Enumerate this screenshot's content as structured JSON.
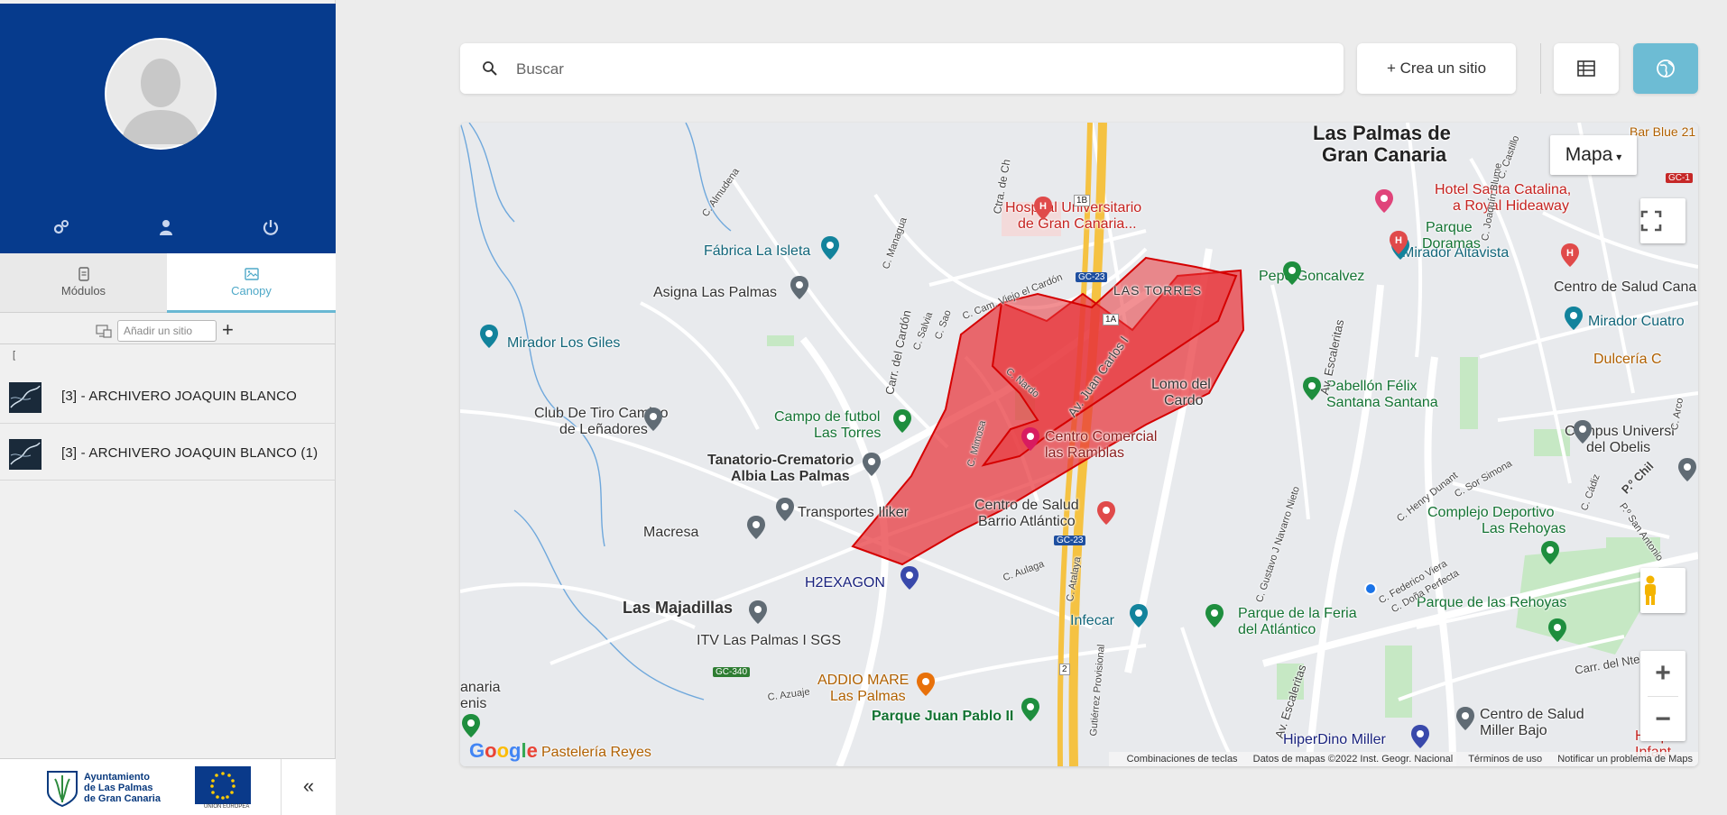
{
  "sidebar": {
    "tabs": [
      {
        "label": "Módulos"
      },
      {
        "label": "Canopy"
      }
    ],
    "add_site_placeholder": "Añadir un sitio",
    "bracket": "[",
    "sites": [
      {
        "label": "[3] - ARCHIVERO JOAQUIN BLANCO"
      },
      {
        "label": "[3] - ARCHIVERO JOAQUIN BLANCO (1)"
      }
    ],
    "footer": {
      "logo_line1": "Ayuntamiento",
      "logo_line2": "de Las Palmas",
      "logo_line3": "de Gran Canaria",
      "eu_text": "UNIÓN EUROPEA",
      "collapse_symbol": "«"
    }
  },
  "toolbar": {
    "search_placeholder": "Buscar",
    "create_label": "+ Crea un sitio"
  },
  "map": {
    "map_type_label": "Mapa",
    "labels": {
      "city": "Las Palmas de",
      "city2": "Gran Canaria",
      "hospital": "Hospital Universitario",
      "hospital2": "de Gran Canaria...",
      "fabrica": "Fábrica La Isleta",
      "asigna": "Asigna Las Palmas",
      "mirador_giles": "Mirador Los Giles",
      "las_torres": "LAS TORRES",
      "pepe": "Pepe Goncalvez",
      "mirador_altavista": "Mirador Altavista",
      "parque_doramas": "Parque",
      "parque_doramas2": "Doramas",
      "hotel": "Hotel Santa Catalina,",
      "hotel2": "a Royal Hideaway",
      "centro_canarias": "Centro de Salud Cana",
      "mirador_cuatro": "Mirador Cuatro",
      "dulceria": "Dulcería C",
      "club": "Club De Tiro Camino",
      "club2": "de Leñadores",
      "campo": "Campo de futbol",
      "campo2": "Las Torres",
      "centro_comercial": "Centro Comercial",
      "centro_comercial2": "las Ramblas",
      "lomo": "Lomo del",
      "lomo2": "Cardo",
      "pabellon": "Pabellón Félix",
      "pabellon2": "Santana Santana",
      "campus": "Campus Universi",
      "campus2": "del Obelis",
      "tanatorio": "Tanatorio-Crematorio",
      "tanatorio2": "Albia Las Palmas",
      "transportes": "Transportes Iliker",
      "macresa": "Macresa",
      "centro_atlantico": "Centro de Salud",
      "centro_atlantico2": "Barrio Atlántico",
      "complejo": "Complejo Deportivo",
      "complejo2": "Las Rehoyas",
      "h2exagon": "H2EXAGON",
      "majadillas": "Las Majadillas",
      "parque_feria": "Parque de la Feria",
      "parque_feria2": "del Atlántico",
      "parque_rehoyas": "Parque de las Rehoyas",
      "itv": "ITV Las Palmas I SGS",
      "infecar": "Infecar",
      "addio": "ADDIO MARE",
      "addio2": "Las Palmas",
      "parque_juan": "Parque Juan Pablo II",
      "centro_miller": "Centro de Salud",
      "centro_miller2": "Miller Bajo",
      "hiperdino": "HiperDino Miller",
      "hospital_right": "Hospita",
      "hospital_right2": "Infant",
      "pasteleria": "Pastelería Reyes",
      "canaria": "anaria",
      "tenis": "enis",
      "av_escaleritas": "Av. Escaleritas",
      "av_escaleritas2": "Av. Escaleritas",
      "carr_cardon": "Carr. del Cardón",
      "av_juan_carlos": "Av. Juan Carlos I",
      "c_mimosa": "C. Mimosa",
      "c_nardo": "C. Nardo",
      "c_azuaje": "C. Azuaje",
      "c_almudena": "C. Almudena",
      "c_sor_simona": "C. Sor Simona",
      "carr_nte": "Carr. del Nte.",
      "c_henry": "C. Henry Dunant",
      "c_gustavo": "C. Gustavo J Navarro Nieto",
      "c_viejo": "C. Cam. Viejo el Cardón",
      "ctra": "Ctra. de Ch",
      "c_manzuga": "C. Managua",
      "c_salvia": "C. Salvia",
      "c_sao": "C. Sao",
      "c_federico": "C. Federico Viera",
      "c_dona": "C. Doña Perfecta",
      "c_cadiz": "C. Cádiz",
      "p_chil": "P.º Chil",
      "p_san": "P.º San Antonio",
      "c_aulaga": "C. Aulaga",
      "c_atalaya": "C. Atalaya",
      "c_joaquin": "C. Joaquín Blume",
      "c_arco": "C. Arco",
      "c_castillo": "C. Castillo",
      "c_gutierrez": "Gutiérrez Provisional",
      "bar": "Bar Blue 21"
    },
    "road_badges": [
      "1B",
      "GC-23",
      "1A",
      "GC-23",
      "GC-340",
      "GC-1",
      "2"
    ],
    "attribution": {
      "keyboard": "Combinaciones de teclas",
      "data": "Datos de mapas ©2022 Inst. Geogr. Nacional",
      "terms": "Términos de uso",
      "report": "Notificar un problema de Maps"
    },
    "colors": {
      "polygon_fill": "#e8343a",
      "polygon_stroke": "#d50000",
      "park": "#c6e8c4",
      "water_line": "#6fa8dc",
      "highway": "#f5c242"
    }
  }
}
